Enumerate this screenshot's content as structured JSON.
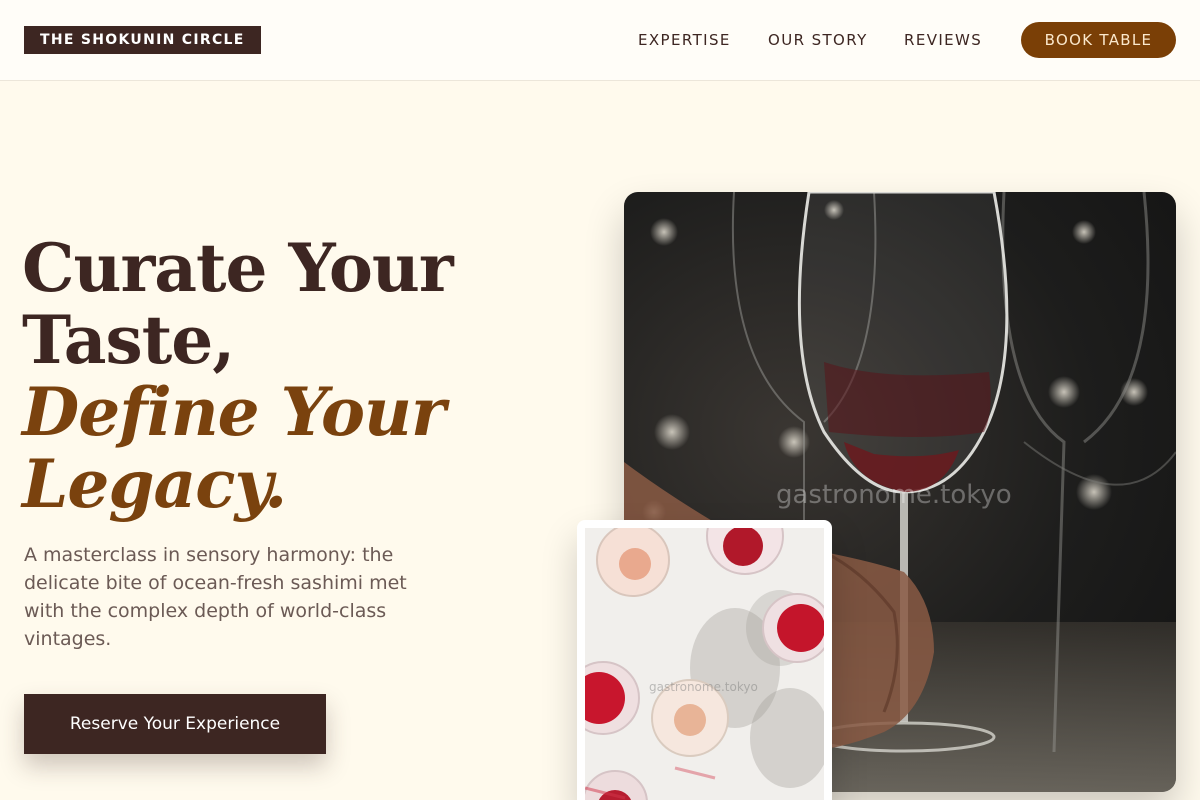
{
  "header": {
    "brand": "THE SHOKUNIN CIRCLE",
    "nav": [
      "EXPERTISE",
      "OUR STORY",
      "REVIEWS"
    ],
    "cta": "BOOK TABLE"
  },
  "hero": {
    "headline_lines": [
      "Curate Your",
      "Taste,"
    ],
    "accent_lines": [
      "Define Your",
      "Legacy."
    ],
    "subtext": "A masterclass in sensory harmony: the delicate bite of ocean-fresh sashimi met with the complex depth of world-class vintages.",
    "cta": "Reserve Your Experience"
  },
  "images": {
    "main_watermark": "gastronome.tokyo",
    "inset_watermark": "gastronome.tokyo"
  },
  "colors": {
    "background": "#fffaed",
    "primary_dark": "#3d2622",
    "accent_brown": "#7a3f06"
  }
}
